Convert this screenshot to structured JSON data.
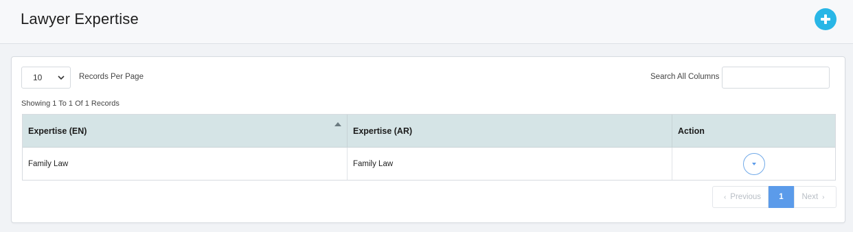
{
  "header": {
    "title": "Lawyer Expertise",
    "add_icon": "plus-circle-icon",
    "accent_color": "#29b6e6"
  },
  "controls": {
    "per_page_value": "10",
    "per_page_label": "Records Per Page",
    "search_label": "Search All Columns",
    "search_value": "",
    "showing_text": "Showing 1 To 1 Of 1 Records"
  },
  "table": {
    "columns": [
      "Expertise (EN)",
      "Expertise (AR)",
      "Action"
    ],
    "sorted_column": "Expertise (EN)",
    "rows": [
      {
        "en": "Family Law",
        "ar": "Family Law",
        "action_icon": "caret-down-icon"
      }
    ],
    "header_color": "#d5e4e6"
  },
  "pagination": {
    "prev_label": "Previous",
    "current_page": "1",
    "next_label": "Next",
    "active_color": "#5b9bea"
  }
}
